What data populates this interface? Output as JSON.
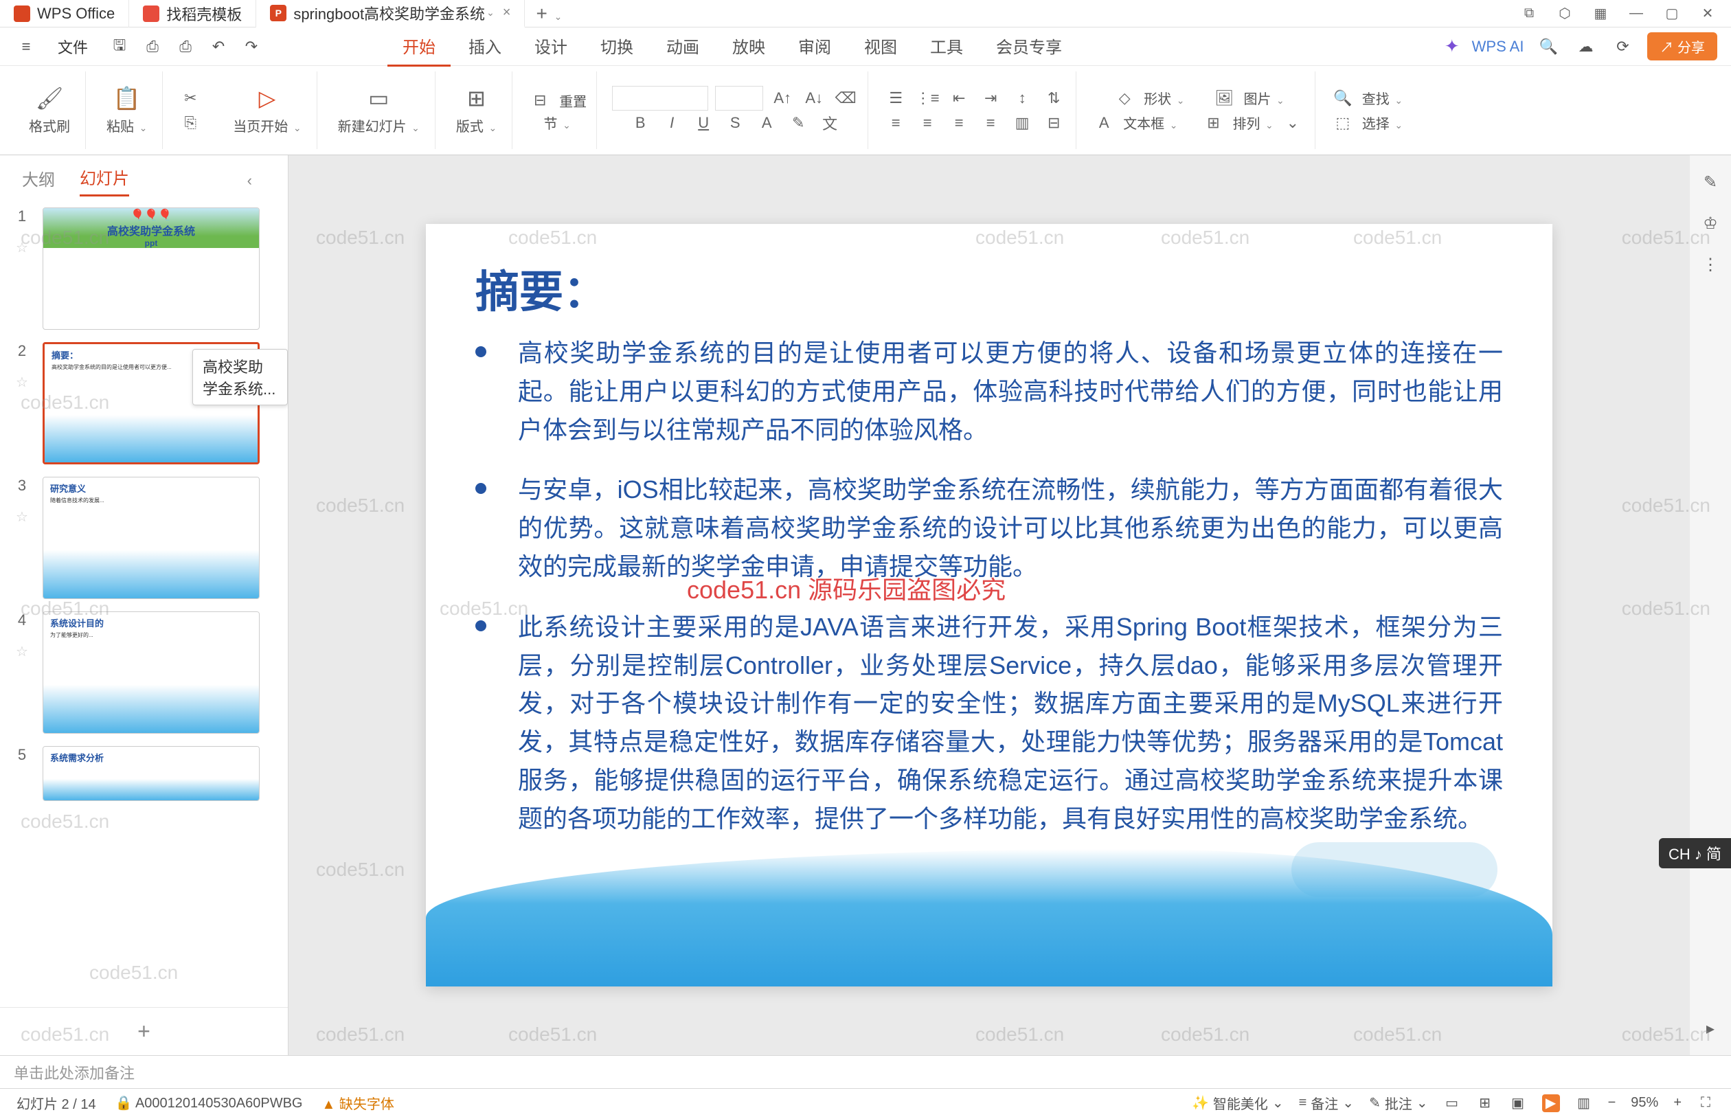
{
  "titlebar": {
    "tabs": [
      {
        "icon": "wps",
        "label": "WPS Office"
      },
      {
        "icon": "shell",
        "label": "找稻壳模板"
      },
      {
        "icon": "ppt",
        "label": "springboot高校奖助学金系统"
      }
    ],
    "close": "×",
    "add": "+"
  },
  "menubar": {
    "file": "文件",
    "tabs": [
      "开始",
      "插入",
      "设计",
      "切换",
      "动画",
      "放映",
      "审阅",
      "视图",
      "工具",
      "会员专享"
    ],
    "active_tab": 0,
    "wps_ai": "WPS AI",
    "share": "分享"
  },
  "ribbon": {
    "format_brush": "格式刷",
    "paste": "粘贴",
    "from_current": "当页开始",
    "new_slide": "新建幻灯片",
    "layout": "版式",
    "section": "节",
    "reset": "重置",
    "shape": "形状",
    "picture": "图片",
    "textbox": "文本框",
    "arrange": "排列",
    "find": "查找",
    "select": "选择"
  },
  "slide_panel": {
    "tabs": [
      "大纲",
      "幻灯片"
    ],
    "active": 1,
    "tooltip": "高校奖助学金系统...",
    "slides": [
      {
        "num": "1",
        "title": "高校奖助学金系统",
        "sub": "ppt"
      },
      {
        "num": "2",
        "title": "摘要："
      },
      {
        "num": "3",
        "title": "研究意义"
      },
      {
        "num": "4",
        "title": "系统设计目的"
      },
      {
        "num": "5",
        "title": "系统需求分析"
      }
    ],
    "add": "+"
  },
  "slide": {
    "title": "摘要：",
    "bullets": [
      "高校奖助学金系统的目的是让使用者可以更方便的将人、设备和场景更立体的连接在一起。能让用户以更科幻的方式使用产品，体验高科技时代带给人们的方便，同时也能让用户体会到与以往常规产品不同的体验风格。",
      "与安卓，iOS相比较起来，高校奖助学金系统在流畅性，续航能力，等方方面面都有着很大的优势。这就意味着高校奖助学金系统的设计可以比其他系统更为出色的能力，可以更高效的完成最新的奖学金申请，申请提交等功能。",
      "此系统设计主要采用的是JAVA语言来进行开发，采用Spring Boot框架技术，框架分为三层，分别是控制层Controller，业务处理层Service，持久层dao，能够采用多层次管理开发，对于各个模块设计制作有一定的安全性；数据库方面主要采用的是MySQL来进行开发，其特点是稳定性好，数据库存储容量大，处理能力快等优势；服务器采用的是Tomcat服务，能够提供稳固的运行平台，确保系统稳定运行。通过高校奖助学金系统来提升本课题的各项功能的工作效率，提供了一个多样功能，具有良好实用性的高校奖助学金系统。"
    ]
  },
  "notes": {
    "placeholder": "单击此处添加备注"
  },
  "statusbar": {
    "slide_info": "幻灯片 2 / 14",
    "id": "A000120140530A60PWBG",
    "missing_font": "缺失字体",
    "beautify": "智能美化",
    "notes_btn": "备注",
    "review": "批注",
    "zoom": "95%"
  },
  "watermarks": {
    "text": "code51.cn",
    "center": "code51.cn 源码乐园盗图必究"
  },
  "ime": "CH ♪ 简"
}
